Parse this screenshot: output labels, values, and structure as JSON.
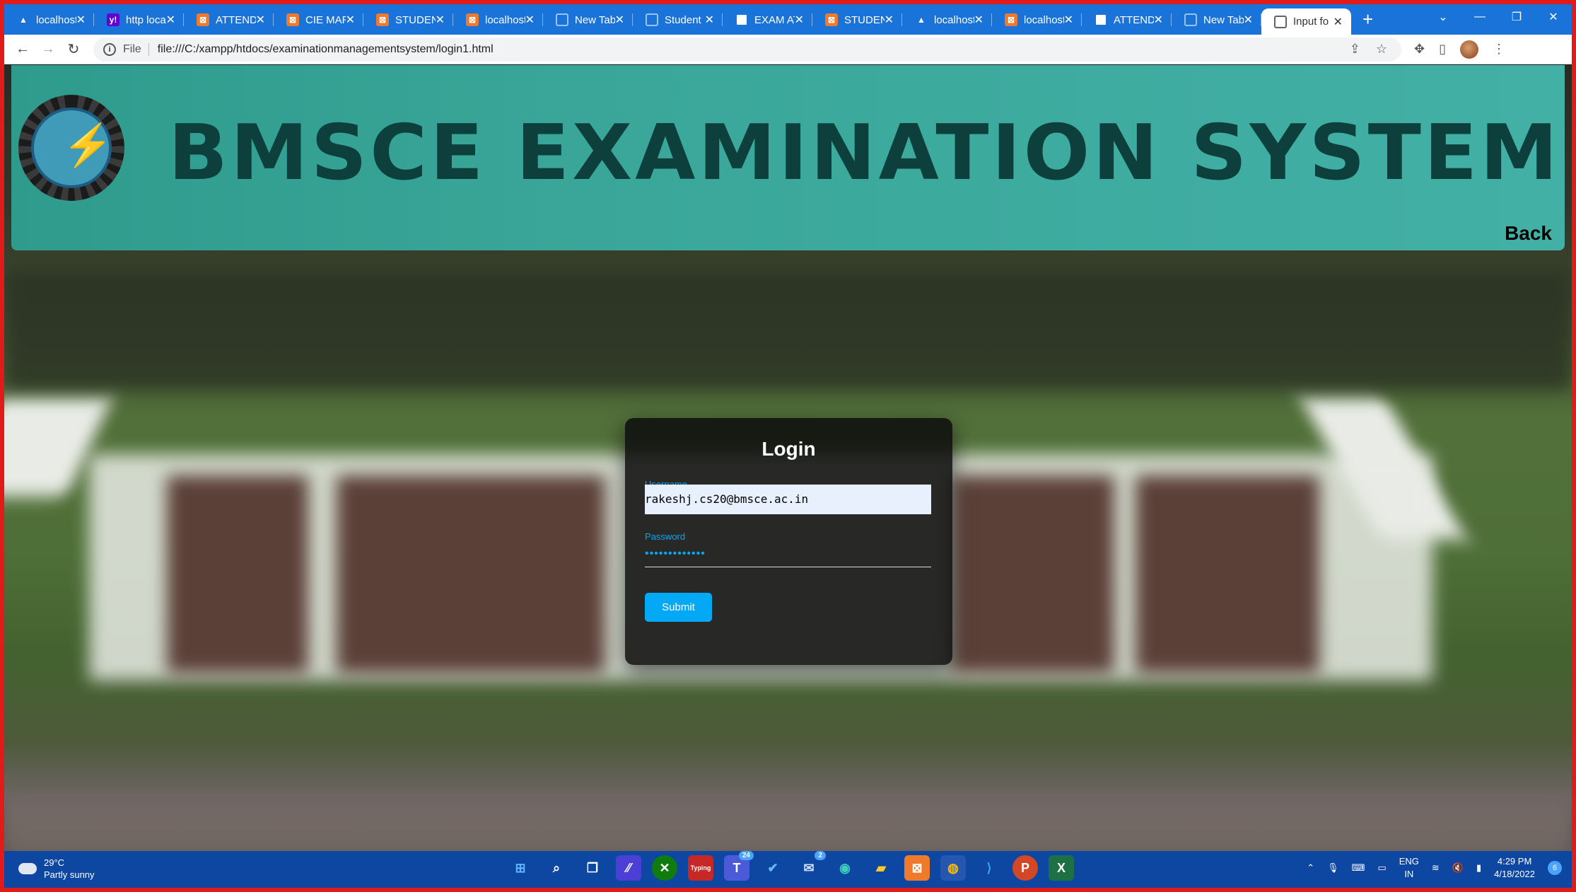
{
  "tabs": [
    {
      "label": "localhost",
      "icon": "apache-icon"
    },
    {
      "label": "http loca",
      "icon": "yahoo-icon"
    },
    {
      "label": "ATTENDA",
      "icon": "xampp-icon"
    },
    {
      "label": "CIE MAR",
      "icon": "xampp-icon"
    },
    {
      "label": "STUDENT",
      "icon": "xampp-icon"
    },
    {
      "label": "localhost",
      "icon": "xampp-icon"
    },
    {
      "label": "New Tab",
      "icon": "globe-icon"
    },
    {
      "label": "Student",
      "icon": "globe-icon"
    },
    {
      "label": "EXAM AT",
      "icon": "document-icon"
    },
    {
      "label": "STUDENT",
      "icon": "xampp-icon"
    },
    {
      "label": "localhost",
      "icon": "apache-icon"
    },
    {
      "label": "localhost",
      "icon": "xampp-icon"
    },
    {
      "label": "ATTENDA",
      "icon": "document-icon"
    },
    {
      "label": "New Tab",
      "icon": "globe-icon"
    },
    {
      "label": "Input fo",
      "icon": "globe-icon",
      "active": true
    }
  ],
  "address": {
    "scheme": "File",
    "url": "file:///C:/xampp/htdocs/examinationmanagementsystem/login1.html"
  },
  "header": {
    "title": "BMSCE EXAMINATION SYSTEM",
    "back_label": "Back"
  },
  "login": {
    "title": "Login",
    "username_label": "Username",
    "username_value": "rakeshj.cs20@bmsce.ac.in",
    "password_label": "Password",
    "password_value": "•••••••••••••",
    "submit_label": "Submit"
  },
  "taskbar": {
    "weather_temp": "29°C",
    "weather_desc": "Partly sunny",
    "lang_top": "ENG",
    "lang_bottom": "IN",
    "time": "4:29 PM",
    "date": "4/18/2022",
    "notification_count": "6",
    "badge_teams": "24",
    "badge_mail": "2",
    "typing_app_label": "Typing"
  },
  "colors": {
    "accent": "#03a9f4",
    "tabstrip": "#1a73d9",
    "header": "#3aa79a",
    "frame": "#e11a1a",
    "taskbar": "#0d47a1"
  }
}
